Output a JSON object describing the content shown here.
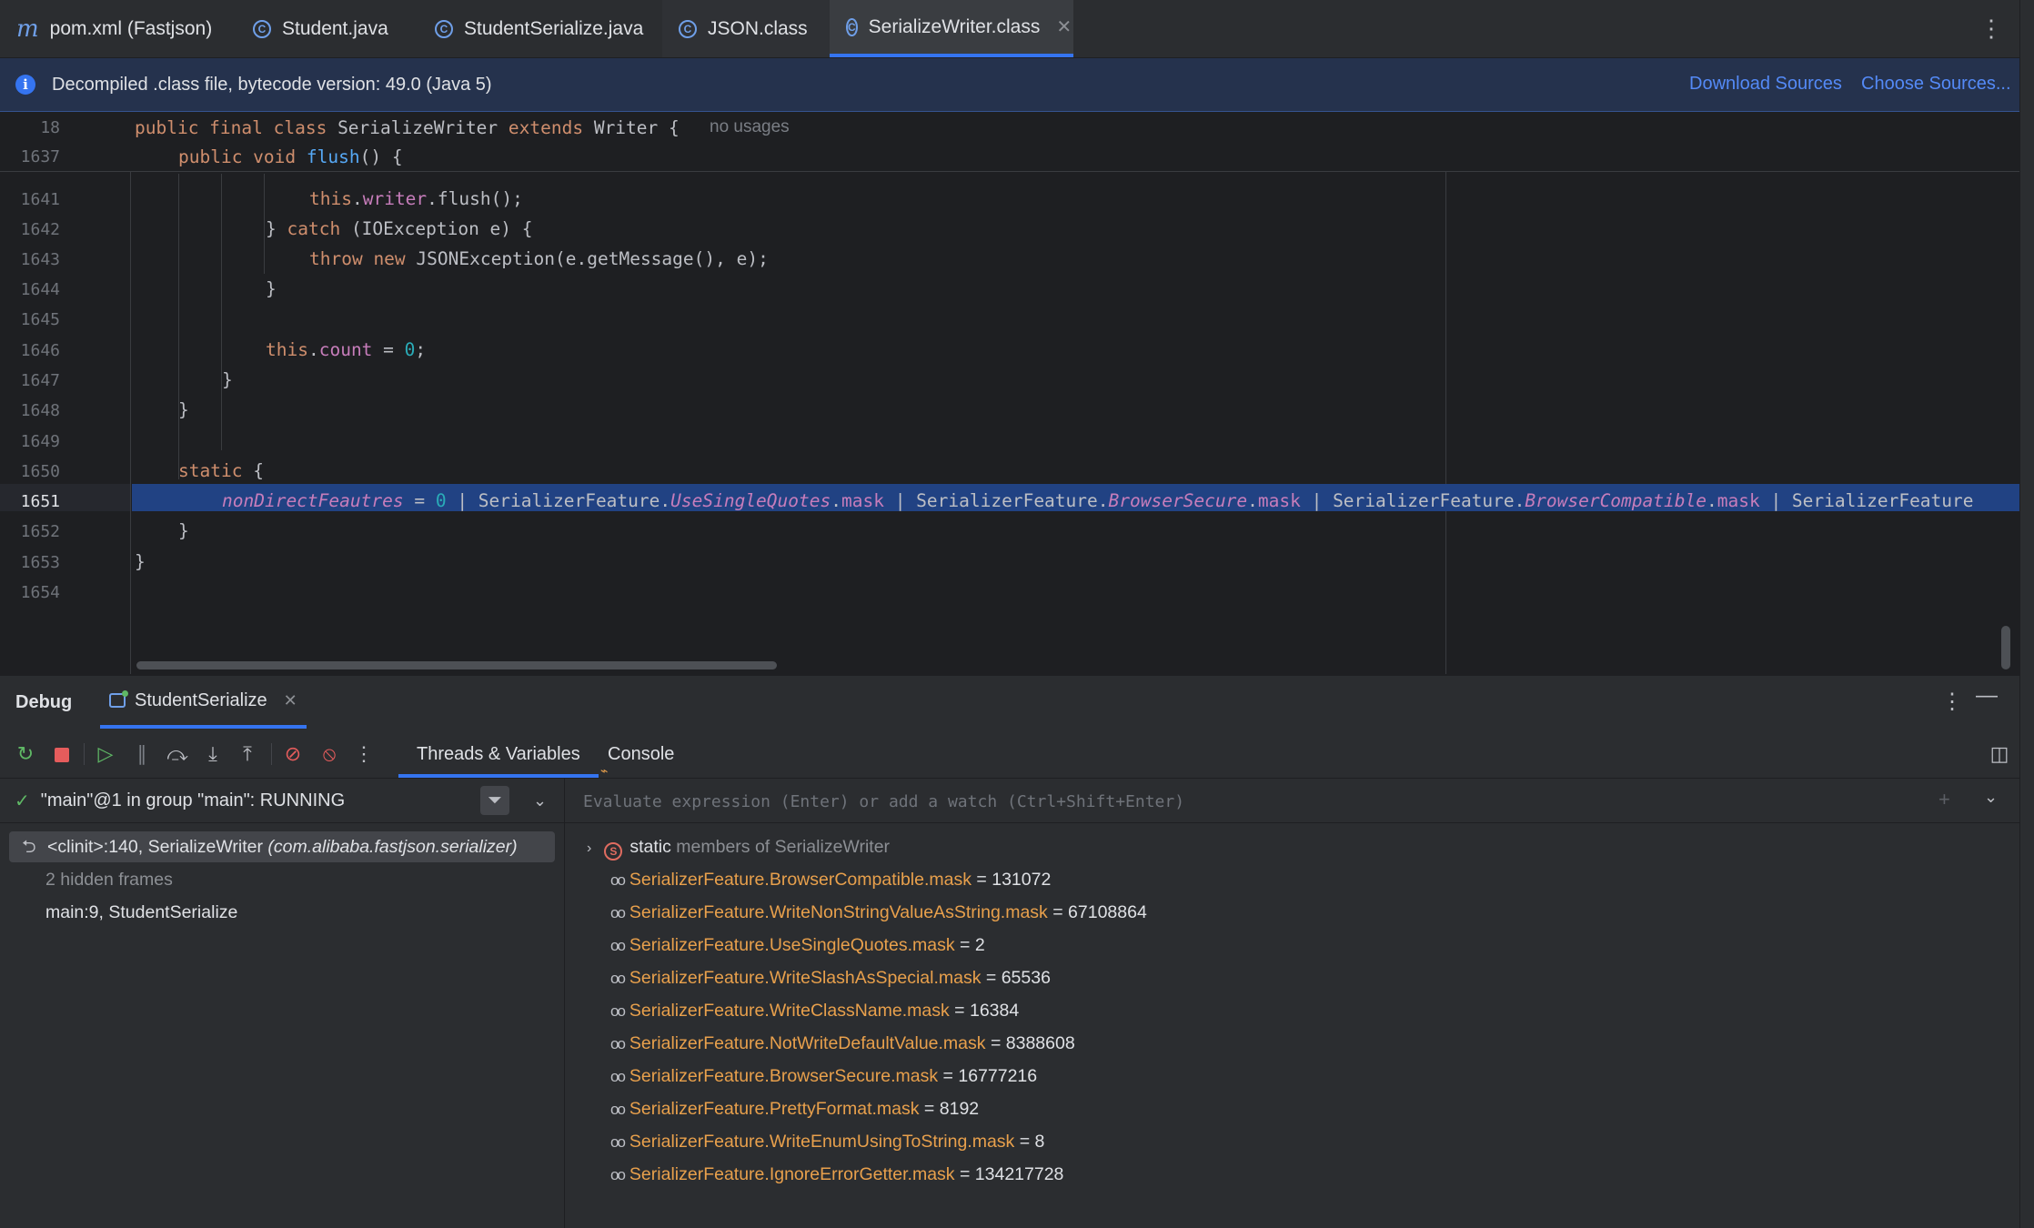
{
  "tabs": [
    {
      "label": "pom.xml (Fastjson)",
      "icon": "maven-m-icon"
    },
    {
      "label": "Student.java",
      "icon": "class-icon"
    },
    {
      "label": "StudentSerialize.java",
      "icon": "class-icon"
    },
    {
      "label": "JSON.class",
      "icon": "class-icon"
    },
    {
      "label": "SerializeWriter.class",
      "icon": "class-icon",
      "active": true
    }
  ],
  "banner": {
    "message": "Decompiled .class file, bytecode version: 49.0 (Java 5)",
    "download_sources": "Download Sources",
    "choose_sources": "Choose Sources..."
  },
  "editor": {
    "sticky": [
      {
        "line": "18",
        "code": "public final class SerializeWriter extends Writer {",
        "hint": "no usages"
      },
      {
        "line": "1637",
        "code": "public void flush() {"
      }
    ],
    "lines": [
      {
        "num": "1641",
        "code": "this.writer.flush();"
      },
      {
        "num": "1642",
        "code": "} catch (IOException e) {"
      },
      {
        "num": "1643",
        "code": "throw new JSONException(e.getMessage(), e);"
      },
      {
        "num": "1644",
        "code": "}"
      },
      {
        "num": "1645",
        "code": ""
      },
      {
        "num": "1646",
        "code": "this.count = 0;"
      },
      {
        "num": "1647",
        "code": "}"
      },
      {
        "num": "1648",
        "code": "}"
      },
      {
        "num": "1649",
        "code": ""
      },
      {
        "num": "1650",
        "code": "static {"
      },
      {
        "num": "1651",
        "code": "nonDirectFeautres = 0 | SerializerFeature.UseSingleQuotes.mask | SerializerFeature.BrowserSecure.mask | SerializerFeature.BrowserCompatible.mask | SerializerFeature",
        "current": true
      },
      {
        "num": "1652",
        "code": "}"
      },
      {
        "num": "1653",
        "code": "}"
      },
      {
        "num": "1654",
        "code": ""
      }
    ]
  },
  "debug": {
    "title": "Debug",
    "session_tab": "StudentSerialize",
    "subtabs": [
      "Threads & Variables",
      "Console"
    ],
    "thread": "\"main\"@1 in group \"main\": RUNNING",
    "frames": [
      {
        "method": "<clinit>:140, SerializeWriter",
        "package": "(com.alibaba.fastjson.serializer)",
        "selected": true
      },
      {
        "method": "2 hidden frames",
        "dim": true
      },
      {
        "method": "main:9, StudentSerialize"
      }
    ],
    "eval_placeholder": "Evaluate expression (Enter) or add a watch (Ctrl+Shift+Enter)",
    "static_row": {
      "prefix": "static",
      "rest": "members of SerializeWriter"
    },
    "variables": [
      {
        "name": "SerializerFeature.BrowserCompatible.mask",
        "value": "131072"
      },
      {
        "name": "SerializerFeature.WriteNonStringValueAsString.mask",
        "value": "67108864"
      },
      {
        "name": "SerializerFeature.UseSingleQuotes.mask",
        "value": "2"
      },
      {
        "name": "SerializerFeature.WriteSlashAsSpecial.mask",
        "value": "65536"
      },
      {
        "name": "SerializerFeature.WriteClassName.mask",
        "value": "16384"
      },
      {
        "name": "SerializerFeature.NotWriteDefaultValue.mask",
        "value": "8388608"
      },
      {
        "name": "SerializerFeature.BrowserSecure.mask",
        "value": "16777216"
      },
      {
        "name": "SerializerFeature.PrettyFormat.mask",
        "value": "8192"
      },
      {
        "name": "SerializerFeature.WriteEnumUsingToString.mask",
        "value": "8"
      },
      {
        "name": "SerializerFeature.IgnoreErrorGetter.mask",
        "value": "134217728"
      }
    ]
  },
  "colors": {
    "accent": "#3574f0",
    "background": "#1e1f22",
    "panel": "#2b2d30",
    "highlight": "#214283"
  }
}
